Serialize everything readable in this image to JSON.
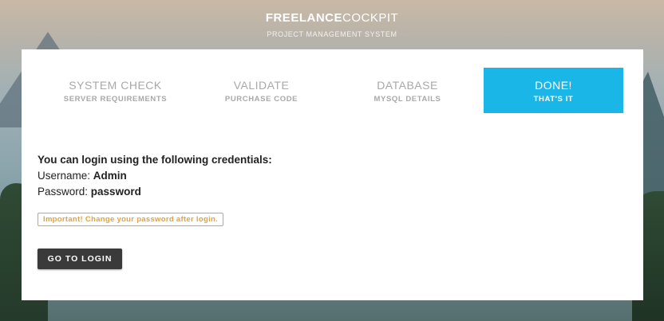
{
  "brand": {
    "title_bold": "FREELANCE",
    "title_light": "COCKPIT",
    "subtitle": "PROJECT MANAGEMENT SYSTEM"
  },
  "steps": [
    {
      "title": "SYSTEM CHECK",
      "subtitle": "SERVER REQUIREMENTS",
      "active": false
    },
    {
      "title": "VALIDATE",
      "subtitle": "PURCHASE CODE",
      "active": false
    },
    {
      "title": "DATABASE",
      "subtitle": "MYSQL DETAILS",
      "active": false
    },
    {
      "title": "DONE!",
      "subtitle": "THAT'S IT",
      "active": true
    }
  ],
  "credentials": {
    "heading": "You can login using the following credentials:",
    "username_label": "Username:",
    "username_value": "Admin",
    "password_label": "Password:",
    "password_value": "password"
  },
  "warning": "Important! Change your password after login.",
  "login_button": "GO TO LOGIN",
  "colors": {
    "accent": "#1ab6e8",
    "warning": "#e0a33e",
    "button_bg": "#3a3a3a",
    "step_inactive": "#a9a9a9"
  }
}
